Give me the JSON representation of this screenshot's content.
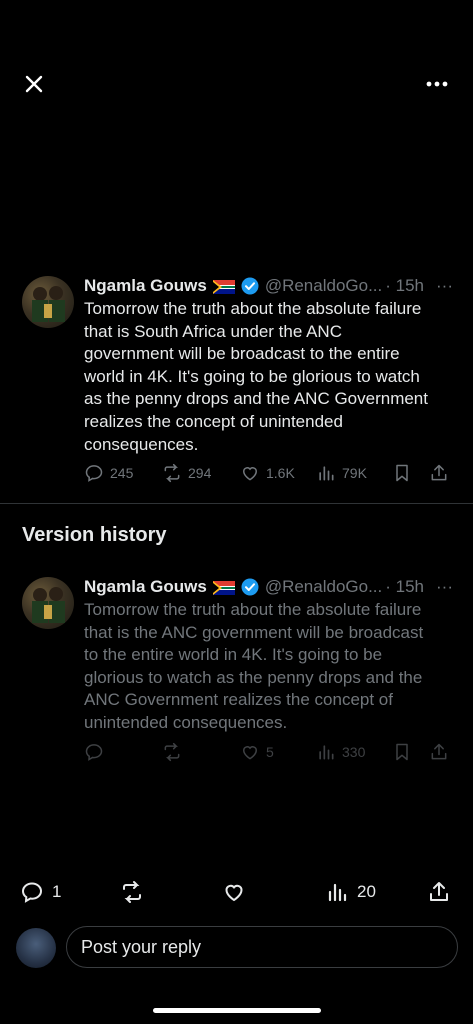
{
  "topbar": {
    "close_icon": "close-icon",
    "more_icon": "more-horizontal-icon"
  },
  "tweet_current": {
    "name": "Ngamla Gouws",
    "flag": "south-africa-flag",
    "handle": "@RenaldoGo...",
    "time": "· 15h",
    "more": "···",
    "text_lines": [
      "Tomorrow the truth about the absolute failure",
      "that is South Africa under the ANC",
      "government will be broadcast to the entire",
      "world in 4K. It's going to be glorious to watch",
      "as the penny drops and the ANC Government",
      "realizes the concept of unintended",
      "consequences."
    ],
    "replies": "245",
    "reposts": "294",
    "likes": "1.6K",
    "views": "79K"
  },
  "version_history": {
    "title": "Version history"
  },
  "tweet_previous": {
    "name": "Ngamla Gouws",
    "flag": "south-africa-flag",
    "handle": "@RenaldoGo...",
    "time": "· 15h",
    "more": "···",
    "text_lines": [
      "Tomorrow the truth about the absolute failure",
      "that is the ANC government will be broadcast",
      "to the entire world in 4K. It's going to be",
      "glorious to watch as the penny drops and the",
      "ANC Government realizes the concept of",
      "unintended consequences."
    ],
    "likes": "5",
    "views": "330"
  },
  "bottom_bar": {
    "replies": "1",
    "views": "20"
  },
  "reply": {
    "placeholder": "Post your reply"
  },
  "colors": {
    "background": "#000000",
    "text": "#e7e9ea",
    "muted": "#71767b",
    "verified": "#1d9bf0"
  }
}
